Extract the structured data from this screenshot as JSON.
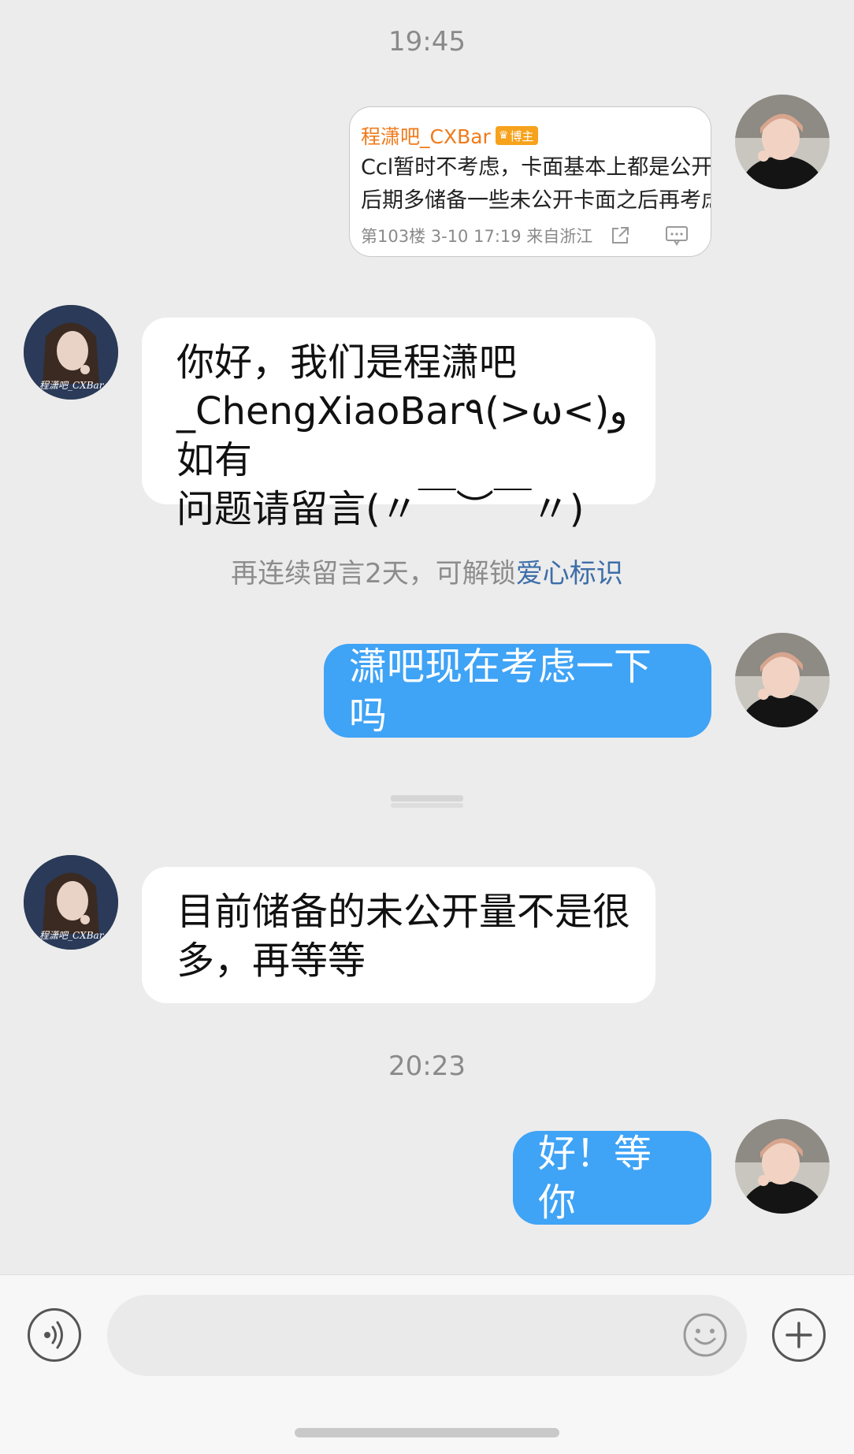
{
  "timestamps": {
    "first": "19:45",
    "second": "20:23"
  },
  "shared_card": {
    "author": "程潇吧_CXBar",
    "badge": "博主",
    "lines": [
      "Ccl暂时不考虑，卡面基本上都是公开的",
      "后期多储备一些未公开卡面之后再考虑"
    ],
    "footer": "第103楼 3-10 17:19 来自浙江"
  },
  "messages": [
    {
      "from": "other",
      "lines": [
        "你好，我们是程潇吧",
        "_ChengXiaoBar٩(>ω<)و如有",
        "问题请留言(〃￣︶￣〃)"
      ]
    },
    {
      "from": "me",
      "text": "潇吧现在考虑一下吗"
    },
    {
      "from": "other",
      "lines": [
        "目前储备的未公开量不是很",
        "多，再等等"
      ]
    },
    {
      "from": "me",
      "text": "好！等你"
    }
  ],
  "notice": {
    "text": "再连续留言2天，可解锁",
    "link": "爱心标识"
  },
  "input": {
    "placeholder": ""
  },
  "icons": {
    "voice": "voice-icon",
    "emoji": "emoji-icon",
    "plus": "plus-icon",
    "share": "share-icon",
    "comment": "comment-icon",
    "avatar_me": "user-avatar",
    "avatar_other": "cxbar-avatar"
  }
}
